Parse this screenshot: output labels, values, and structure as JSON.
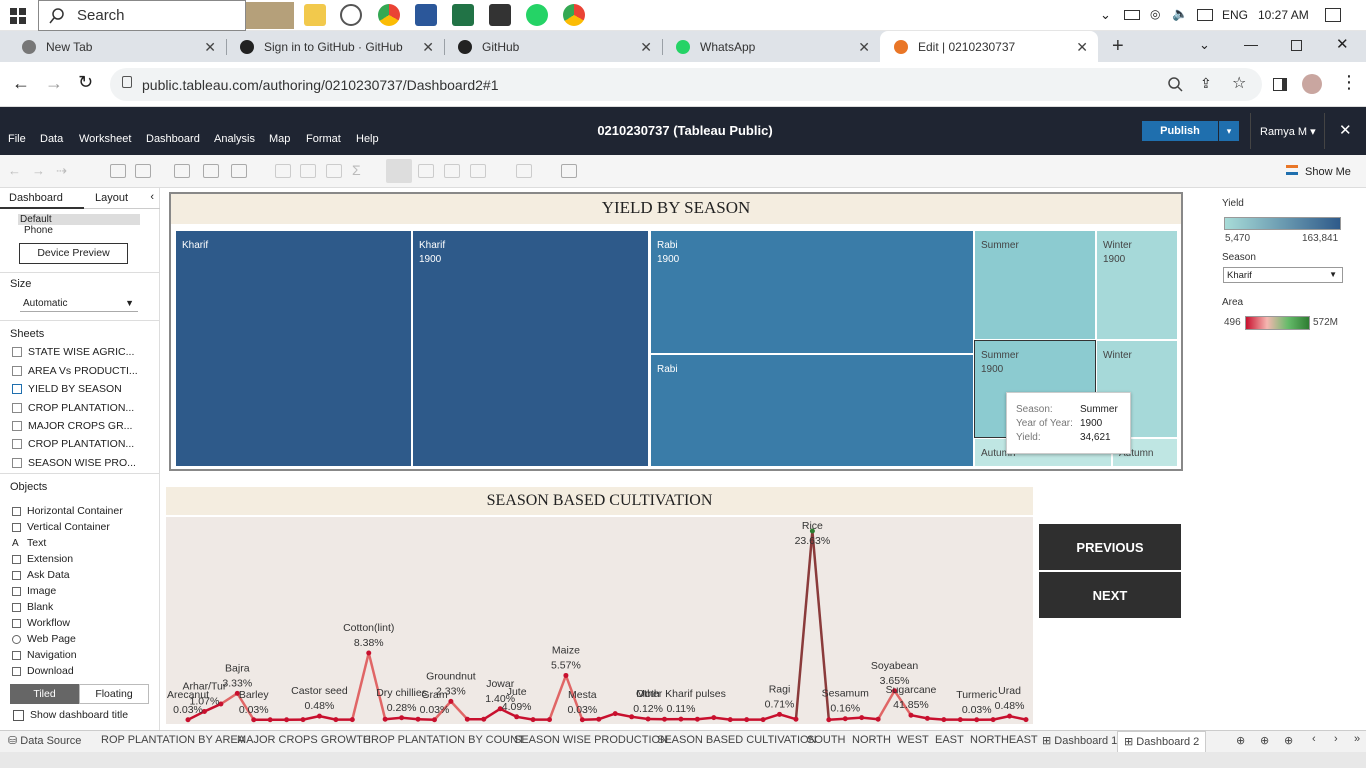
{
  "taskbar": {
    "search_placeholder": "Search",
    "language": "ENG",
    "time": "10:27 AM"
  },
  "tabs": [
    {
      "label": "New Tab"
    },
    {
      "label": "Sign in to GitHub · GitHub"
    },
    {
      "label": "GitHub"
    },
    {
      "label": "WhatsApp"
    },
    {
      "label": "Edit | 0210230737"
    }
  ],
  "address": {
    "url": "public.tableau.com/authoring/0210230737/Dashboard2#1"
  },
  "tableau": {
    "menu": [
      "File",
      "Data",
      "Worksheet",
      "Dashboard",
      "Analysis",
      "Map",
      "Format",
      "Help"
    ],
    "title": "0210230737 (Tableau Public)",
    "publish": "Publish",
    "user": "Ramya M",
    "show_me": "Show Me"
  },
  "leftpane": {
    "tab_dashboard": "Dashboard",
    "tab_layout": "Layout",
    "device_default": "Default",
    "device_phone": "Phone",
    "device_preview": "Device Preview",
    "size_label": "Size",
    "size_value": "Automatic",
    "sheets_label": "Sheets",
    "sheets": [
      "STATE WISE AGRIC...",
      "AREA Vs PRODUCTI...",
      "YIELD BY SEASON",
      "CROP PLANTATION...",
      "MAJOR CROPS GR...",
      "CROP PLANTATION...",
      "SEASON WISE PRO..."
    ],
    "objects_label": "Objects",
    "objects": [
      "Horizontal Container",
      "Vertical Container",
      "Text",
      "Extension",
      "Ask Data",
      "Image",
      "Blank",
      "Workflow",
      "Web Page",
      "Navigation",
      "Download"
    ],
    "tiled": "Tiled",
    "floating": "Floating",
    "show_title": "Show dashboard title"
  },
  "treemap": {
    "title": "YIELD BY SEASON",
    "cells": [
      {
        "season": "Kharif",
        "year": ""
      },
      {
        "season": "Kharif",
        "year": "1900"
      },
      {
        "season": "Rabi",
        "year": "1900"
      },
      {
        "season": "Rabi",
        "year": ""
      },
      {
        "season": "Summer",
        "year": ""
      },
      {
        "season": "Winter",
        "year": "1900"
      },
      {
        "season": "Summer",
        "year": "1900"
      },
      {
        "season": "Winter",
        "year": ""
      },
      {
        "season": "Autumn",
        "year": ""
      },
      {
        "season": "Autumn",
        "year": ""
      }
    ],
    "tooltip": {
      "k1": "Season:",
      "v1": "Summer",
      "k2": "Year of Year:",
      "v2": "1900",
      "k3": "Yield:",
      "v3": "34,621"
    }
  },
  "legends": {
    "yield_title": "Yield",
    "yield_min": "5,470",
    "yield_max": "163,841",
    "season_title": "Season",
    "season_value": "Kharif",
    "area_title": "Area",
    "area_min": "496",
    "area_max": "572M"
  },
  "chart_data": {
    "type": "line",
    "title": "SEASON BASED CULTIVATION",
    "points": [
      {
        "label": "Arecanut",
        "pct": "0.03%",
        "v": 0.03
      },
      {
        "label": "Arhar/Tur",
        "pct": "1.07%",
        "v": 1.07
      },
      {
        "label": "",
        "pct": "",
        "v": 2.0
      },
      {
        "label": "Bajra",
        "pct": "3.33%",
        "v": 3.33
      },
      {
        "label": "Barley",
        "pct": "0.03%",
        "v": 0.03
      },
      {
        "label": "",
        "pct": "",
        "v": 0.03
      },
      {
        "label": "",
        "pct": "",
        "v": 0.03
      },
      {
        "label": "",
        "pct": "",
        "v": 0.05
      },
      {
        "label": "Castor seed",
        "pct": "0.48%",
        "v": 0.48
      },
      {
        "label": "",
        "pct": "",
        "v": 0.05
      },
      {
        "label": "",
        "pct": "",
        "v": 0.05
      },
      {
        "label": "Cotton(lint)",
        "pct": "8.38%",
        "v": 8.38
      },
      {
        "label": "",
        "pct": "",
        "v": 0.1
      },
      {
        "label": "Dry chillies",
        "pct": "0.28%",
        "v": 0.28
      },
      {
        "label": "",
        "pct": "",
        "v": 0.1
      },
      {
        "label": "Gram",
        "pct": "0.03%",
        "v": 0.03
      },
      {
        "label": "Groundnut",
        "pct": "2.33%",
        "v": 2.33
      },
      {
        "label": "",
        "pct": "",
        "v": 0.1
      },
      {
        "label": "",
        "pct": "",
        "v": 0.1
      },
      {
        "label": "Jowar",
        "pct": "1.40%",
        "v": 1.4
      },
      {
        "label": "Jute",
        "pct": "4.09%",
        "v": 0.4
      },
      {
        "label": "",
        "pct": "",
        "v": 0.05
      },
      {
        "label": "",
        "pct": "",
        "v": 0.05
      },
      {
        "label": "Maize",
        "pct": "5.57%",
        "v": 5.57
      },
      {
        "label": "Mesta",
        "pct": "0.03%",
        "v": 0.03
      },
      {
        "label": "",
        "pct": "",
        "v": 0.1
      },
      {
        "label": "",
        "pct": "",
        "v": 0.8
      },
      {
        "label": "",
        "pct": "",
        "v": 0.4
      },
      {
        "label": "Moth",
        "pct": "0.12%",
        "v": 0.12
      },
      {
        "label": "",
        "pct": "",
        "v": 0.1
      },
      {
        "label": "Other Kharif pulses",
        "pct": "0.11%",
        "v": 0.11
      },
      {
        "label": "",
        "pct": "",
        "v": 0.1
      },
      {
        "label": "",
        "pct": "",
        "v": 0.3
      },
      {
        "label": "",
        "pct": "",
        "v": 0.05
      },
      {
        "label": "",
        "pct": "",
        "v": 0.05
      },
      {
        "label": "",
        "pct": "",
        "v": 0.05
      },
      {
        "label": "Ragi",
        "pct": "0.71%",
        "v": 0.71
      },
      {
        "label": "",
        "pct": "",
        "v": 0.1
      },
      {
        "label": "Rice",
        "pct": "23.63%",
        "v": 23.63
      },
      {
        "label": "",
        "pct": "",
        "v": 0.03
      },
      {
        "label": "Sesamum",
        "pct": "0.16%",
        "v": 0.16
      },
      {
        "label": "",
        "pct": "",
        "v": 0.3
      },
      {
        "label": "",
        "pct": "",
        "v": 0.1
      },
      {
        "label": "Soyabean",
        "pct": "3.65%",
        "v": 3.65
      },
      {
        "label": "Sugarcane",
        "pct": "41.85%",
        "v": 0.6
      },
      {
        "label": "",
        "pct": "",
        "v": 0.2
      },
      {
        "label": "",
        "pct": "",
        "v": 0.05
      },
      {
        "label": "",
        "pct": "",
        "v": 0.05
      },
      {
        "label": "Turmeric",
        "pct": "0.03%",
        "v": 0.03
      },
      {
        "label": "",
        "pct": "",
        "v": 0.05
      },
      {
        "label": "Urad",
        "pct": "0.48%",
        "v": 0.48
      },
      {
        "label": "",
        "pct": "",
        "v": 0.05
      }
    ],
    "ylim": [
      0,
      24
    ]
  },
  "nav": {
    "previous": "PREVIOUS",
    "next": "NEXT"
  },
  "bottom_tabs": [
    "Data Source",
    "ROP PLANTATION BY AREA",
    "MAJOR CROPS GROWTH",
    "CROP PLANTATION BY COUNT",
    "SEASON WISE PRODUCTION",
    "SEASON BASED CULTIVATION",
    "SOUTH",
    "NORTH",
    "WEST",
    "EAST",
    "NORTHEAST",
    "Dashboard 1",
    "Dashboard 2"
  ],
  "colors": {
    "header": "#1f2532",
    "publish": "#1f6fae",
    "dark_cell": "#2e5a8a",
    "mid_cell": "#3a7ca8",
    "light_cell": "#8ccbd0",
    "line_red": "#c8102e",
    "line_green": "#2e7d32"
  }
}
